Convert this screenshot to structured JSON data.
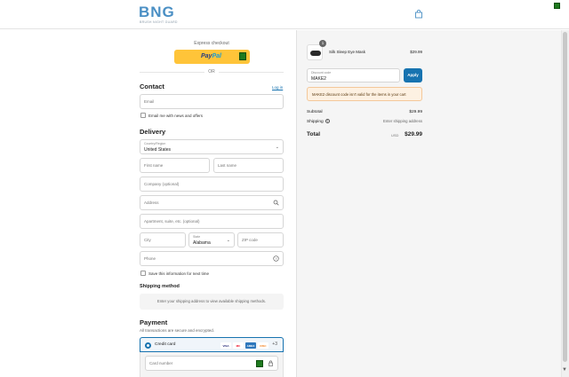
{
  "brand": {
    "name": "BNG",
    "tagline": "BRUSH NIGHT GUARD",
    "accent": "#4a8fc4"
  },
  "header": {
    "cart_icon": "shopping-bag-icon"
  },
  "express": {
    "label": "Express checkout",
    "paypal_pay": "Pay",
    "paypal_pal": "Pal",
    "or_label": "OR"
  },
  "contact": {
    "title": "Contact",
    "login_link": "Log in",
    "email_placeholder": "Email",
    "newsletter_label": "Email me with news and offers",
    "newsletter_checked": false
  },
  "delivery": {
    "title": "Delivery",
    "country_label": "Country/Region",
    "country_value": "United States",
    "first_name_placeholder": "First name",
    "last_name_placeholder": "Last name",
    "company_placeholder": "Company (optional)",
    "address_placeholder": "Address",
    "apartment_placeholder": "Apartment, suite, etc. (optional)",
    "city_placeholder": "City",
    "state_label": "State",
    "state_value": "Alabama",
    "zip_placeholder": "ZIP code",
    "phone_placeholder": "Phone",
    "save_info_label": "Save this information for next time",
    "save_info_checked": false
  },
  "shipping": {
    "title": "Shipping method",
    "message": "Enter your shipping address to view available shipping methods."
  },
  "payment": {
    "title": "Payment",
    "subtitle": "All transactions are secure and encrypted.",
    "method_label": "Credit card",
    "card_brands": [
      "VISA",
      "MC",
      "AMEX",
      "DISC"
    ],
    "more_label": "+3",
    "card_number_placeholder": "Card number"
  },
  "order": {
    "items": [
      {
        "name": "Silk Sleep Eye Mask",
        "price": "$29.99",
        "quantity": "1"
      }
    ],
    "discount": {
      "label": "Discount code",
      "value": "MAKE2",
      "apply_label": "Apply"
    },
    "error": "MAKE2 discount code isn't valid for the items in your cart",
    "subtotal_label": "Subtotal",
    "subtotal_value": "$29.99",
    "shipping_label": "Shipping",
    "shipping_value": "Enter shipping address",
    "total_label": "Total",
    "total_currency": "USD",
    "total_value": "$29.99"
  }
}
